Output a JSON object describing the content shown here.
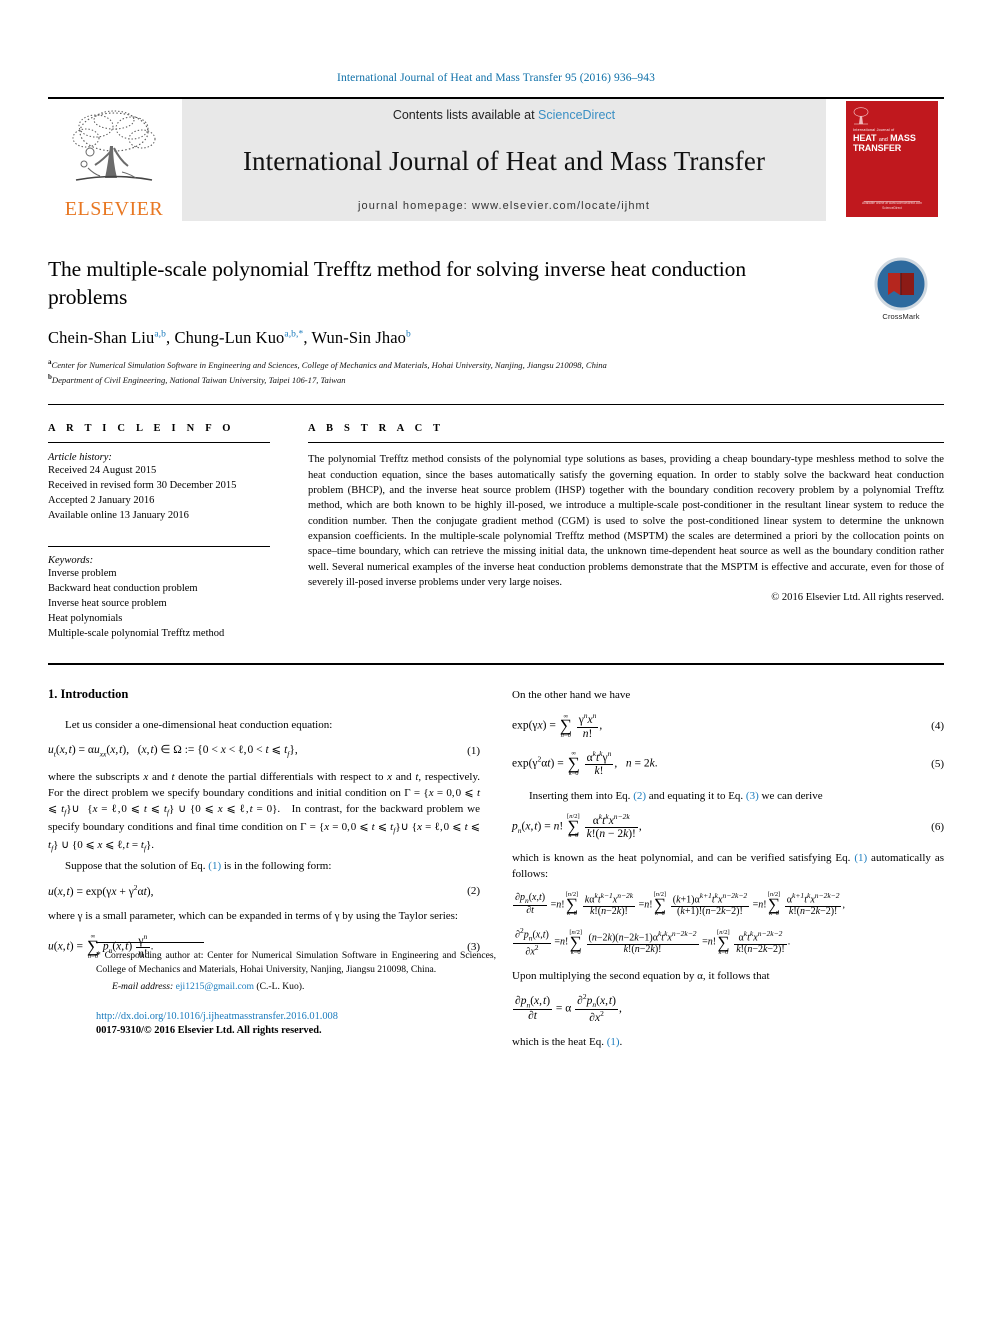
{
  "running_head": "International Journal of Heat and Mass Transfer 95 (2016) 936–943",
  "masthead": {
    "elsevier_wordmark": "ELSEVIER",
    "contents_prefix": "Contents lists available at",
    "sciencedirect": "ScienceDirect",
    "journal_title": "International Journal of Heat and Mass Transfer",
    "homepage": "journal homepage: www.elsevier.com/locate/ijhmt",
    "cover": {
      "small_title": "International Journal of",
      "big_title_line1": "HEAT",
      "big_title_and": "and",
      "big_title_line1b": "MASS",
      "big_title_line2": "TRANSFER",
      "footer_line1": "Available online at www.sciencedirect.com",
      "footer_line2": "ScienceDirect"
    },
    "cover_bg": "#c0181e"
  },
  "article": {
    "title": "The multiple-scale polynomial Trefftz method for solving inverse heat conduction problems",
    "authors_html": "Chein-Shan Liu, Chung-Lun Kuo, Wun-Sin Jhao",
    "author_list": [
      {
        "name": "Chein-Shan Liu",
        "marks": "a,b"
      },
      {
        "name": "Chung-Lun Kuo",
        "marks": "a,b,*"
      },
      {
        "name": "Wun-Sin Jhao",
        "marks": "b"
      }
    ],
    "affiliation_a": "Center for Numerical Simulation Software in Engineering and Sciences, College of Mechanics and Materials, Hohai University, Nanjing, Jiangsu 210098, China",
    "affiliation_b": "Department of Civil Engineering, National Taiwan University, Taipei 106-17, Taiwan",
    "crossmark_label": "CrossMark"
  },
  "info": {
    "heading": "A R T I C L E    I N F O",
    "history_title": "Article history:",
    "history": [
      "Received 24 August 2015",
      "Received in revised form 30 December 2015",
      "Accepted 2 January 2016",
      "Available online 13 January 2016"
    ],
    "keywords_title": "Keywords:",
    "keywords": [
      "Inverse problem",
      "Backward heat conduction problem",
      "Inverse heat source problem",
      "Heat polynomials",
      "Multiple-scale polynomial Trefftz method"
    ]
  },
  "abstract": {
    "heading": "A B S T R A C T",
    "text": "The polynomial Trefftz method consists of the polynomial type solutions as bases, providing a cheap boundary-type meshless method to solve the heat conduction equation, since the bases automatically satisfy the governing equation. In order to stably solve the backward heat conduction problem (BHCP), and the inverse heat source problem (IHSP) together with the boundary condition recovery problem by a polynomial Trefftz method, which are both known to be highly ill-posed, we introduce a multiple-scale post-conditioner in the resultant linear system to reduce the condition number. Then the conjugate gradient method (CGM) is used to solve the post-conditioned linear system to determine the unknown expansion coefficients. In the multiple-scale polynomial Trefftz method (MSPTM) the scales are determined a priori by the collocation points on space–time boundary, which can retrieve the missing initial data, the unknown time-dependent heat source as well as the boundary condition rather well. Several numerical examples of the inverse heat conduction problems demonstrate that the MSPTM is effective and accurate, even for those of severely ill-posed inverse problems under very large noises.",
    "copyright": "© 2016 Elsevier Ltd. All rights reserved."
  },
  "body": {
    "section_heading": "1. Introduction",
    "left": {
      "p1": "Let us consider a one-dimensional heat conduction equation:",
      "eq1_no": "(1)",
      "p2_a": "where the subscripts ",
      "p2_b": " and ",
      "p2_c": " denote the partial differentials with respect to ",
      "p2_d": " and ",
      "p2_e": ", respectively. For the direct problem we specify boundary conditions and initial condition on",
      "p3": "In contrast, for the backward problem we specify boundary conditions and final time condition on",
      "p4_pre": "Suppose that the solution of Eq. ",
      "p4_link": "(1)",
      "p4_post": " is in the following form:",
      "eq2_no": "(2)",
      "p5": "where γ is a small parameter, which can be expanded in terms of γ by using the Taylor series:",
      "eq3_no": "(3)"
    },
    "right": {
      "p1": "On the other hand we have",
      "eq4_no": "(4)",
      "eq5_no": "(5)",
      "p2_pre": "Inserting them into Eq. ",
      "p2_link1": "(2)",
      "p2_mid": " and equating it to Eq. ",
      "p2_link2": "(3)",
      "p2_post": " we can derive",
      "eq6_no": "(6)",
      "p3_pre": "which is known as the heat polynomial, and can be verified satisfying Eq. ",
      "p3_link": "(1)",
      "p3_post": " automatically as follows:",
      "p4": "Upon multiplying the second equation by α, it follows that",
      "p5_pre": "which is the heat Eq. ",
      "p5_link": "(1)",
      "p5_post": "."
    }
  },
  "footer": {
    "corresponding_marker": "*",
    "corresponding": "Corresponding author at: Center for Numerical Simulation Software in Engineering and Sciences, College of Mechanics and Materials, Hohai University, Nanjing, Jiangsu 210098, China.",
    "email_label": "E-mail address:",
    "email": "eji1215@gmail.com",
    "email_owner": "(C.-L. Kuo).",
    "doi": "http://dx.doi.org/10.1016/j.ijheatmasstransfer.2016.01.008",
    "issn_line": "0017-9310/© 2016 Elsevier Ltd. All rights reserved."
  },
  "colors": {
    "link": "#1b7bbd",
    "elsevier_orange": "#e87722",
    "sciencedirect": "#3a8fc4",
    "cover_red": "#c0181e",
    "banner_grey": "#e8e8e8"
  }
}
